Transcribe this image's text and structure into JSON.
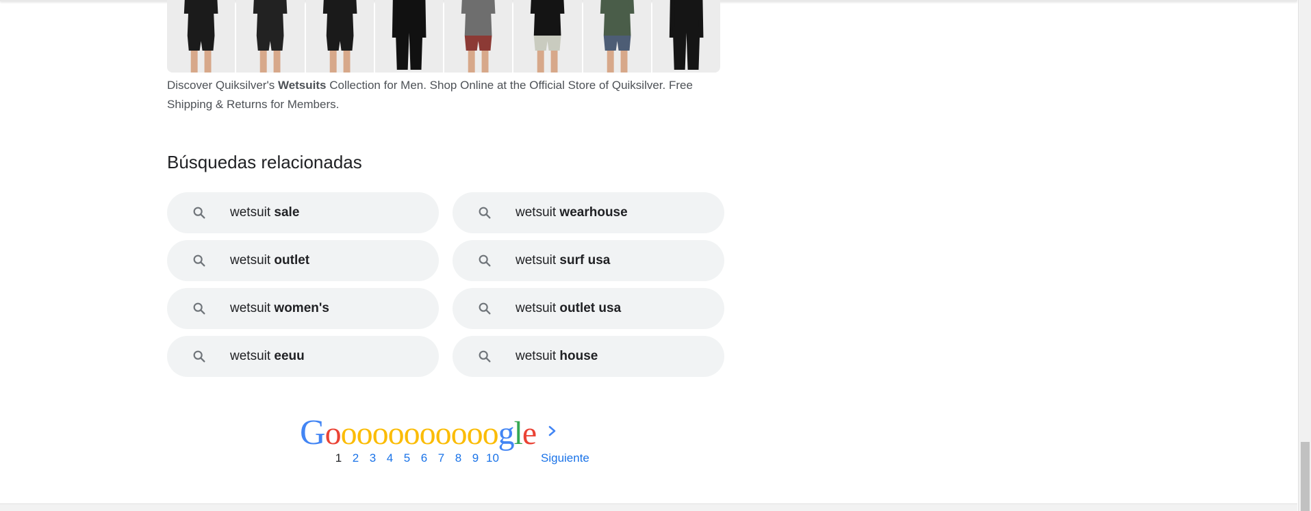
{
  "products": {
    "thumbnails": [
      {
        "name": "spring-suit",
        "top": "#1b1b1b",
        "bottom": "#1b1b1b",
        "short": true
      },
      {
        "name": "short-sleeve-spring-suit",
        "top": "#222",
        "bottom": "#222",
        "short": true
      },
      {
        "name": "short-sleeve-wetsuit-logo",
        "top": "#1a1a1a",
        "bottom": "#1a1a1a",
        "short": true
      },
      {
        "name": "long-sleeve-top",
        "top": "#111",
        "bottom": "#111",
        "short": false
      },
      {
        "name": "grey-top-red-shorts",
        "top": "#6e6e6e",
        "bottom": "#8c3a35",
        "short": true
      },
      {
        "name": "black-top-patterned-shorts",
        "top": "#141414",
        "bottom": "#c9cbbf",
        "short": true
      },
      {
        "name": "green-top-camo-shorts",
        "top": "#4a5d49",
        "bottom": "#4d5d75",
        "short": true
      },
      {
        "name": "full-wetsuit",
        "top": "#151515",
        "bottom": "#151515",
        "short": false
      }
    ]
  },
  "snippet": {
    "prefix": "Discover Quiksilver's ",
    "bold": "Wetsuits",
    "suffix": " Collection for Men. Shop Online at the Official Store of Quiksilver. Free Shipping & Returns for Members."
  },
  "related": {
    "title": "Búsquedas relacionadas",
    "items": [
      {
        "base": "wetsuit ",
        "bold": "sale"
      },
      {
        "base": "wetsuit ",
        "bold": "wearhouse"
      },
      {
        "base": "wetsuit ",
        "bold": "outlet"
      },
      {
        "base": "wetsuit ",
        "bold": "surf usa"
      },
      {
        "base": "wetsuit ",
        "bold": "women's"
      },
      {
        "base": "wetsuit ",
        "bold": "outlet usa"
      },
      {
        "base": "wetsuit ",
        "bold": "eeuu"
      },
      {
        "base": "wetsuit ",
        "bold": "house"
      }
    ],
    "icon": "search-icon"
  },
  "pagination": {
    "logo_letters": [
      "G",
      "o",
      "o",
      "o",
      "o",
      "o",
      "o",
      "o",
      "o",
      "o",
      "o",
      "o",
      "g",
      "l",
      "e"
    ],
    "pages": [
      "1",
      "2",
      "3",
      "4",
      "5",
      "6",
      "7",
      "8",
      "9",
      "10"
    ],
    "current_page": "1",
    "next_label": "Siguiente"
  },
  "colors": {
    "google_blue": "#4285f4",
    "google_red": "#ea4335",
    "google_yellow": "#fbbc05",
    "google_green": "#34a853",
    "link": "#1a73e8",
    "chip_bg": "#f1f3f4"
  }
}
